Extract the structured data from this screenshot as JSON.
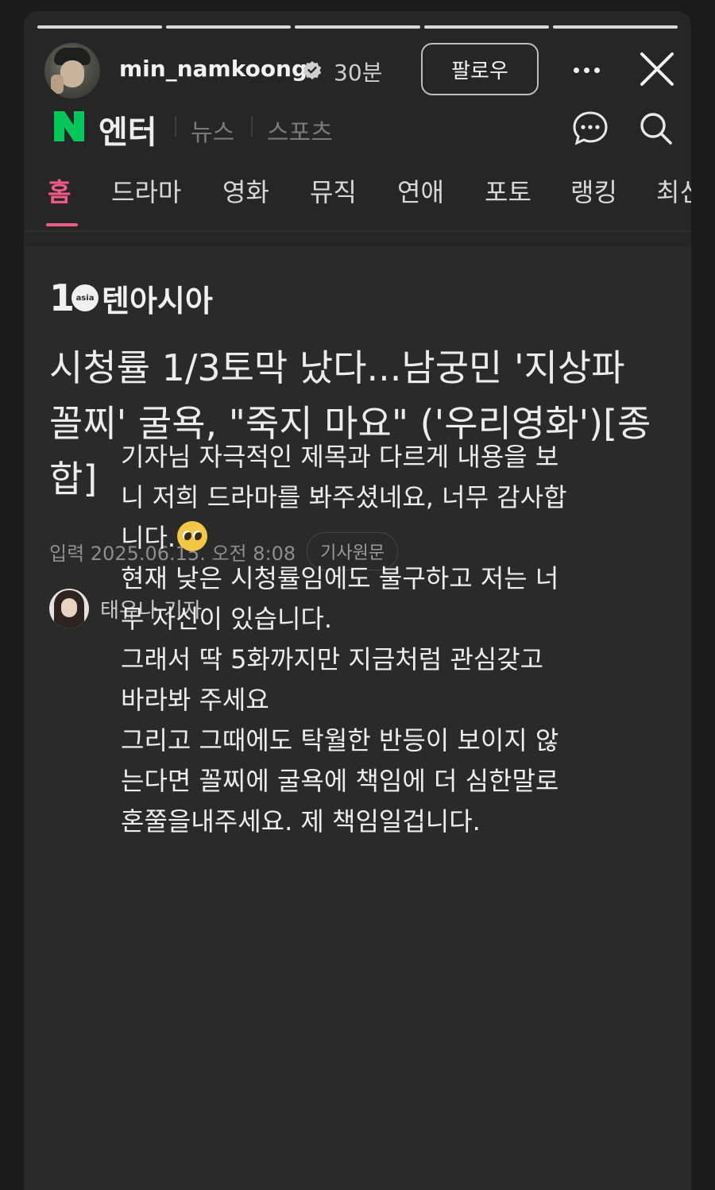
{
  "story": {
    "username": "min_namkoong",
    "time": "30분",
    "follow_label": "팔로우",
    "progress_segments": 5
  },
  "site": {
    "logo_letter": "N",
    "section": "엔터",
    "sub_links": [
      "뉴스",
      "스포츠"
    ]
  },
  "tabs": [
    "홈",
    "드라마",
    "영화",
    "뮤직",
    "연애",
    "포토",
    "랭킹",
    "최신"
  ],
  "article": {
    "publisher_mark": "1",
    "publisher_circle": "asia",
    "publisher_name": "텐아시아",
    "headline": "시청률 1/3토막 났다...남궁민 '지상파 꼴찌' 굴욕, \"죽지 마요\" ('우리영화')[종합]",
    "date": "입력 2025.06.15. 오전 8:08",
    "original_button": "기사원문",
    "reporter": "태유나 기자"
  },
  "comment": {
    "lines": [
      "기자님 자극적인 제목과 다르게 내용을 보",
      "니 저희 드라마를 봐주셨네요, 너무 감사합",
      "니다.",
      "현재 낮은 시청률임에도 불구하고 저는 너",
      "무 자신이 있습니다.",
      "그래서 딱 5화까지만 지금처럼 관심갖고",
      "바라봐 주세요",
      "그리고 그때에도 탁월한 반등이 보이지 않",
      "는다면 꼴찌에 굴욕에 책임에 더 심한말로",
      "혼쭐을내주세요. 제 책임일겁니다."
    ]
  },
  "colors": {
    "accent": "#f05a8a",
    "naver_green": "#03c75a"
  }
}
